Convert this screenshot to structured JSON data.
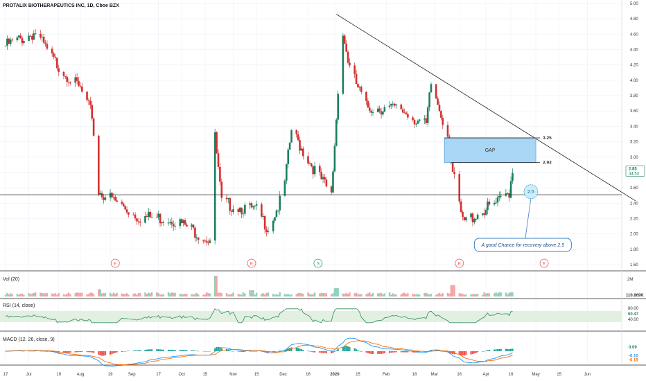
{
  "header": {
    "symbol": "PROTALIX BIOTHERAPEUTICS INC, 1D, Cboe BZX"
  },
  "chart_data": {
    "type": "candlestick",
    "price_axis": {
      "min": 1.6,
      "max": 5.0,
      "ticks": [
        "5.00",
        "4.80",
        "4.60",
        "4.40",
        "4.20",
        "4.00",
        "3.80",
        "3.60",
        "3.40",
        "3.20",
        "3.00",
        "2.80",
        "2.60",
        "2.40",
        "2.20",
        "2.00",
        "1.80",
        "1.60"
      ]
    },
    "time_axis": {
      "labels": [
        "17",
        "Jul",
        "19",
        "Aug",
        "19",
        "Sep",
        "17",
        "Oct",
        "15",
        "Nov",
        "15",
        "Dec",
        "16",
        "2020",
        "15",
        "Feb",
        "18",
        "Mar",
        "16",
        "Apr",
        "16",
        "May",
        "15",
        "Jun"
      ]
    },
    "last_price": "2.85",
    "last_price_sub": "44:53",
    "horizontal_line": 2.51,
    "trendline": {
      "from": {
        "date": "2020-01-02",
        "price": 4.86
      },
      "to": {
        "date": "2020-06-30",
        "price": 2.43
      }
    },
    "gap": {
      "label": "GAP",
      "top": "3.25",
      "bottom": "2.93"
    },
    "annotation": {
      "level": "2.5",
      "text": "A good Chance for recovery above 2.5"
    },
    "events": [
      "E",
      "E",
      "S",
      "E",
      "E"
    ],
    "volume": {
      "title": "Vol (20)",
      "axis_label": "2M",
      "last": "110.869K"
    },
    "rsi": {
      "title": "RSI (14, close)",
      "ticks": [
        "80.00",
        "40.00"
      ],
      "last": "60.47",
      "upper": 70,
      "lower": 30
    },
    "macd": {
      "title": "MACD (12, 26, close, 9)",
      "values": [
        "0.09",
        "-0.10",
        "-0.19"
      ]
    },
    "colors": {
      "up": "#1b7f5b",
      "down": "#d32f2f",
      "gap": "#a9d6f5",
      "rsi_line": "#2e8b57",
      "rsi_band": "#e2f0e2",
      "macd": "#2196f3",
      "signal": "#ff6d00"
    }
  }
}
